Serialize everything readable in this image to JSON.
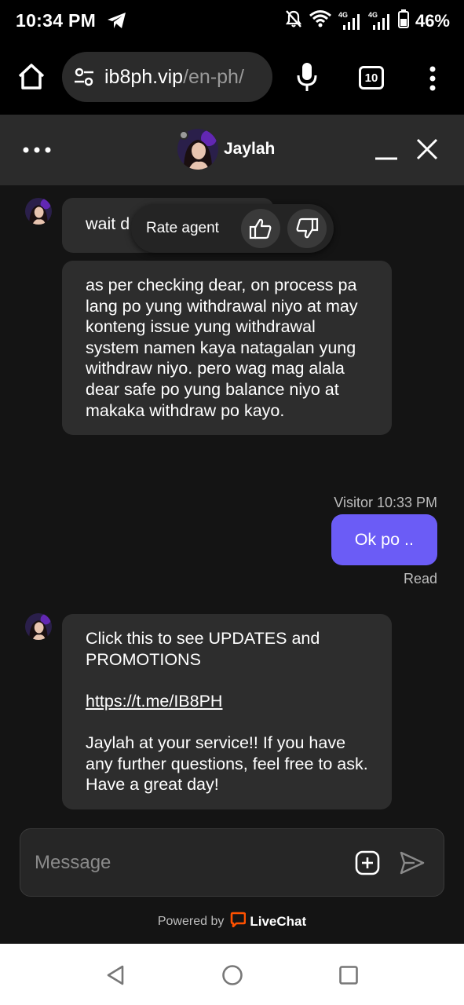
{
  "status_bar": {
    "time": "10:34 PM",
    "battery": "46%",
    "icons": [
      "telegram-icon",
      "mute-icon",
      "wifi-icon",
      "signal-4g-icon",
      "signal-4g-icon",
      "battery-icon"
    ],
    "network_labels": [
      "4G",
      "4G"
    ]
  },
  "browser": {
    "url_domain": "ib8ph.vip",
    "url_path": "/en-ph/",
    "tab_count": "10"
  },
  "chat_header": {
    "agent_name": "Jaylah"
  },
  "messages": {
    "agent_msg_1": "wait d",
    "rate_agent_label": "Rate agent",
    "agent_msg_2": "as per checking dear, on process pa lang po yung withdrawal niyo at may konteng issue yung withdrawal system namen kaya natagalan yung withdraw niyo. pero wag mag alala dear safe po yung balance niyo at makaka withdraw po kayo.",
    "visitor_meta": "Visitor 10:33 PM",
    "visitor_msg": "Ok po ..",
    "read_receipt": "Read",
    "agent_msg_3_line1": "Click this to see UPDATES and PROMOTIONS",
    "agent_msg_3_link": "https://t.me/IB8PH",
    "agent_msg_3_line2": "Jaylah at your service!! If you have any further questions, feel free to ask. Have a great day!"
  },
  "composer": {
    "placeholder": "Message"
  },
  "footer": {
    "powered_by": "Powered by",
    "brand": "LiveChat"
  },
  "colors": {
    "visitor_bubble": "#6b5cf6",
    "agent_bubble": "#2d2d2d",
    "livechat_orange": "#ff5100"
  }
}
